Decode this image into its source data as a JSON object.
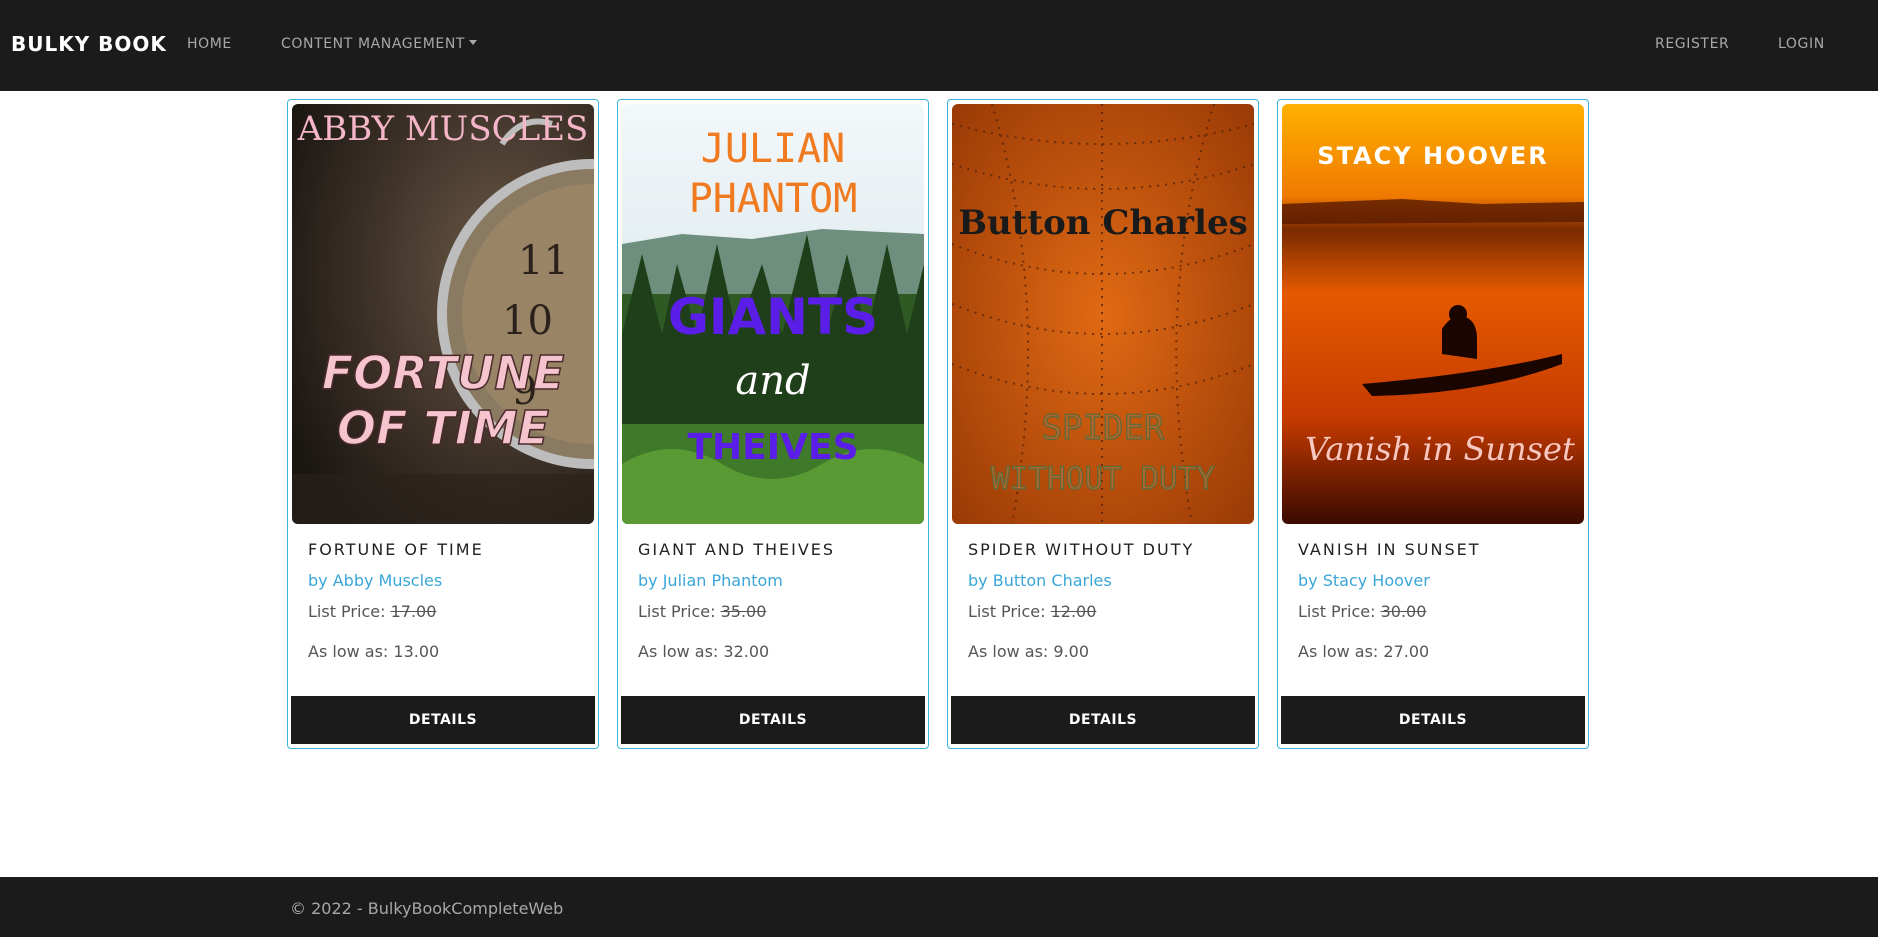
{
  "navbar": {
    "brand": "BULKY BOOK",
    "home": "HOME",
    "content_management": "CONTENT MANAGEMENT",
    "register": "REGISTER",
    "login": "LOGIN"
  },
  "products": [
    {
      "cover": {
        "author": "ABBY MUSCLES",
        "title_line1": "FORTUNE",
        "title_line2": "OF TIME"
      },
      "title": "FORTUNE OF TIME",
      "author": "by Abby Muscles",
      "list_price_label": "List Price:",
      "list_price": "17.00",
      "low_price": "As low as: 13.00",
      "details": "DETAILS"
    },
    {
      "cover": {
        "author_line1": "JULIAN",
        "author_line2": "PHANTOM",
        "title_line1": "GIANTS",
        "title_line2": "and",
        "title_line3": "THEIVES"
      },
      "title": "GIANT AND THEIVES",
      "author": "by Julian Phantom",
      "list_price_label": "List Price:",
      "list_price": "35.00",
      "low_price": "As low as: 32.00",
      "details": "DETAILS"
    },
    {
      "cover": {
        "author": "Button Charles",
        "title_line1": "SPIDER",
        "title_line2": "WITHOUT DUTY"
      },
      "title": "SPIDER WITHOUT DUTY",
      "author": "by Button Charles",
      "list_price_label": "List Price:",
      "list_price": "12.00",
      "low_price": "As low as: 9.00",
      "details": "DETAILS"
    },
    {
      "cover": {
        "author": "STACY HOOVER",
        "title": "Vanish in Sunset"
      },
      "title": "VANISH IN SUNSET",
      "author": "by Stacy Hoover",
      "list_price_label": "List Price:",
      "list_price": "30.00",
      "low_price": "As low as: 27.00",
      "details": "DETAILS"
    }
  ],
  "footer": {
    "text": "© 2022 - BulkyBookCompleteWeb"
  }
}
